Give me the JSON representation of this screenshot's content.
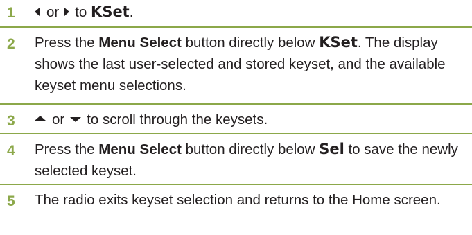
{
  "colors": {
    "step_number": "#8ca84a",
    "divider": "#8ca84a",
    "text": "#231f20"
  },
  "steps": [
    {
      "number": "1",
      "arrow_left_icon": "left-triangle-icon",
      "or": "or",
      "arrow_right_icon": "right-triangle-icon",
      "to": "to",
      "keyword": "KSet",
      "period": "."
    },
    {
      "number": "2",
      "text_a": "Press the ",
      "bold": "Menu Select",
      "text_b": " button directly below ",
      "keyword": "KSet",
      "text_c": ". The display shows the last user-selected and stored keyset, and the available keyset menu selections."
    },
    {
      "number": "3",
      "arrow_up_icon": "up-triangle-icon",
      "or": "or",
      "arrow_down_icon": "down-triangle-icon",
      "text": "to scroll through the keysets."
    },
    {
      "number": "4",
      "text_a": "Press the ",
      "bold": "Menu Select",
      "text_b": " button directly below ",
      "keyword": "Sel",
      "text_c": " to save the newly selected keyset."
    },
    {
      "number": "5",
      "text": "The radio exits keyset selection and returns to the Home screen."
    }
  ]
}
